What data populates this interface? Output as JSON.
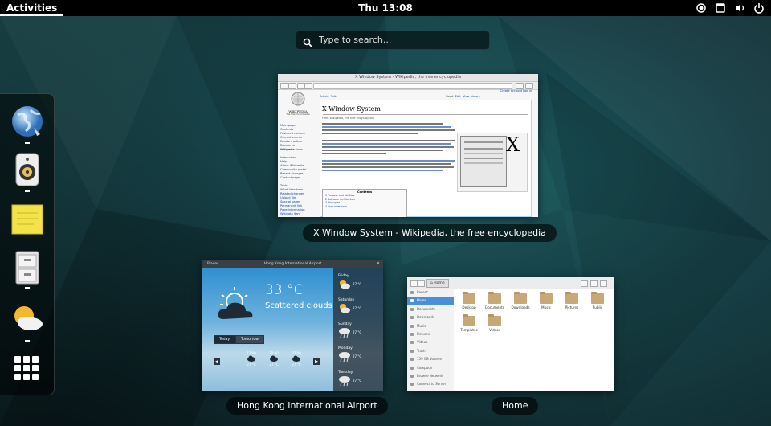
{
  "topbar": {
    "activities": "Activities",
    "clock": "Thu 13:08",
    "tray_icons": [
      "record-icon",
      "window-icon",
      "volume-icon",
      "power-icon"
    ]
  },
  "search": {
    "placeholder": "Type to search..."
  },
  "dash": {
    "apps": [
      {
        "name": "web-browser"
      },
      {
        "name": "rhythmbox"
      },
      {
        "name": "sticky-notes"
      },
      {
        "name": "file-cabinet"
      },
      {
        "name": "weather"
      }
    ],
    "show_apps": "show-applications-icon"
  },
  "windows": {
    "wiki": {
      "caption": "X Window System - Wikipedia, the free encyclopedia",
      "titlebar": "X Window System - Wikipedia, the free encyclopedia",
      "heading": "X Window System",
      "logo_text": "WIKIPEDIA",
      "tagline": "The Free Encyclopedia",
      "tabs": [
        "Article",
        "Talk"
      ],
      "actions": [
        "Read",
        "Edit",
        "View history"
      ],
      "account": "Create account  Log in",
      "side_links": [
        "Main page",
        "Contents",
        "Featured content",
        "Current events",
        "Random article",
        "Donate to Wikipedia",
        "Wikipedia store",
        "",
        "Interaction",
        "Help",
        "About Wikipedia",
        "Community portal",
        "Recent changes",
        "Contact page",
        "",
        "Tools",
        "What links here",
        "Related changes",
        "Upload file",
        "Special pages",
        "Permanent link",
        "Page information",
        "Wikidata item"
      ],
      "from": "From Wikipedia, the free encyclopedia",
      "contents": "Contents",
      "toc": [
        "1 Purpose and abilities",
        "2 Software architecture",
        "3 Principles",
        "4 User interfaces"
      ],
      "image_glyph": "X"
    },
    "weather": {
      "caption": "Hong Kong International Airport",
      "places": "Places",
      "title": "Hong Kong International Airport",
      "subtitle": "Today",
      "temp": "33 °C",
      "condition": "Scattered clouds",
      "toggle": [
        "Today",
        "Tomorrow"
      ],
      "hours": [
        "17:00",
        "20:00",
        "23:00"
      ],
      "hour_temps": [
        "27 °C",
        "27 °C",
        "27 °C"
      ],
      "days": [
        {
          "day": "Friday",
          "temp": "27 °C"
        },
        {
          "day": "Saturday",
          "temp": "27 °C"
        },
        {
          "day": "Sunday",
          "temp": "27 °C"
        },
        {
          "day": "Monday",
          "temp": "27 °C"
        },
        {
          "day": "Tuesday",
          "temp": "27 °C"
        }
      ]
    },
    "files": {
      "caption": "Home",
      "path": "Home",
      "sidebar": [
        "Recent",
        "Home",
        "Documents",
        "Downloads",
        "Music",
        "Pictures",
        "Videos",
        "Trash",
        "159 GB Volume",
        "Computer",
        "Browse Network",
        "Connect to Server"
      ],
      "folders": [
        "Desktop",
        "Documents",
        "Downloads",
        "Music",
        "Pictures",
        "Public",
        "Templates",
        "Videos"
      ]
    }
  }
}
